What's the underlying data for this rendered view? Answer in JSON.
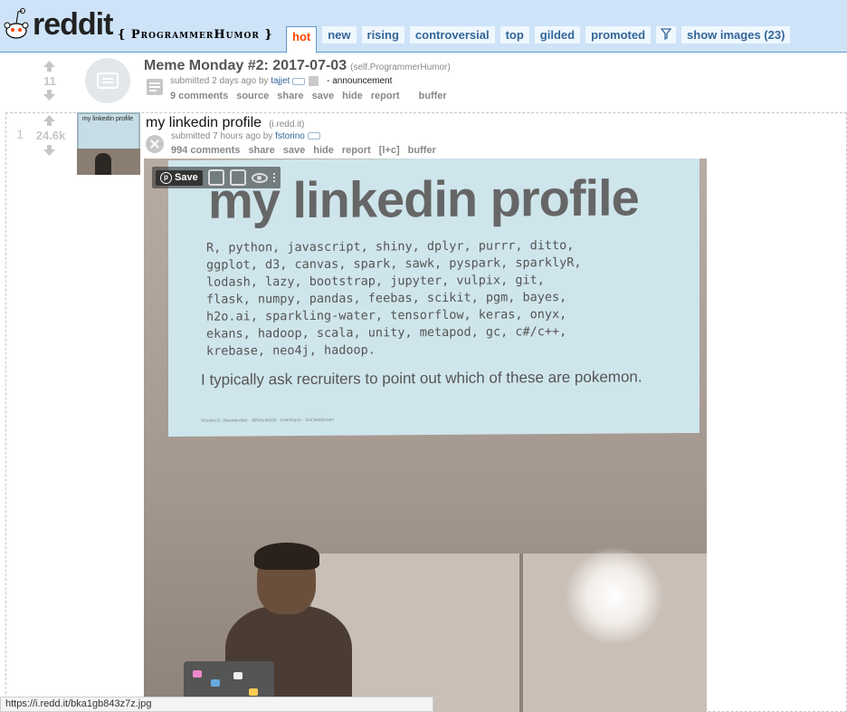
{
  "header": {
    "logo_text": "reddit",
    "subreddit": "{ ProgrammerHumor }",
    "tabs": [
      {
        "label": "hot",
        "selected": true
      },
      {
        "label": "new"
      },
      {
        "label": "rising"
      },
      {
        "label": "controversial"
      },
      {
        "label": "top"
      },
      {
        "label": "gilded"
      },
      {
        "label": "promoted"
      },
      {
        "label": "show images (23)"
      }
    ],
    "filter_icon": "funnel-icon"
  },
  "posts": [
    {
      "rank": "",
      "score": "11",
      "title": "Meme Monday #2: 2017-07-03",
      "domain": "(self.ProgrammerHumor)",
      "tagline_prefix": "submitted 2 days ago by",
      "author": "tajjet",
      "flair": "- announcement",
      "buttons": [
        "9 comments",
        "source",
        "share",
        "save",
        "hide",
        "report",
        "buffer"
      ]
    },
    {
      "rank": "1",
      "score": "24.6k",
      "title": "my linkedin profile",
      "domain": "(i.redd.it)",
      "tagline_prefix": "submitted 7 hours ago by",
      "author": "fstorino",
      "buttons": [
        "994 comments",
        "share",
        "save",
        "hide",
        "report",
        "[l+c]",
        "buffer"
      ]
    }
  ],
  "thumbnail": {
    "caption": "my linkedin profile"
  },
  "image": {
    "slide_title": "my linkedin profile",
    "slide_body": "R, python, javascript, shiny, dplyr, purrr, ditto,\nggplot, d3, canvas, spark, sawk, pyspark, sparklyR,\nlodash, lazy, bootstrap, jupyter, vulpix, git,\nflask, numpy, pandas, feebas, scikit, pgm, bayes,\nh2o.ai, sparkling-water, tensorflow, keras, onyx,\nekans, hadoop, scala, unity, metapod, gc, c#/c++,\nkrebase, neo4j, hadoop.",
    "slide_foot": "I typically ask recruiters to point out which of these are pokemon.",
    "slide_credit": "Vincent D. Warmerdam · @fishnetsdit · koaning.io · GoDataDriven",
    "save_label": "Save"
  },
  "statusbar": {
    "url": "https://i.redd.it/bka1gb843z7z.jpg"
  },
  "colors": {
    "header_bg": "#cee3f8",
    "tab_text": "#336699",
    "selected_tab": "#ff4500",
    "muted": "#888888"
  }
}
